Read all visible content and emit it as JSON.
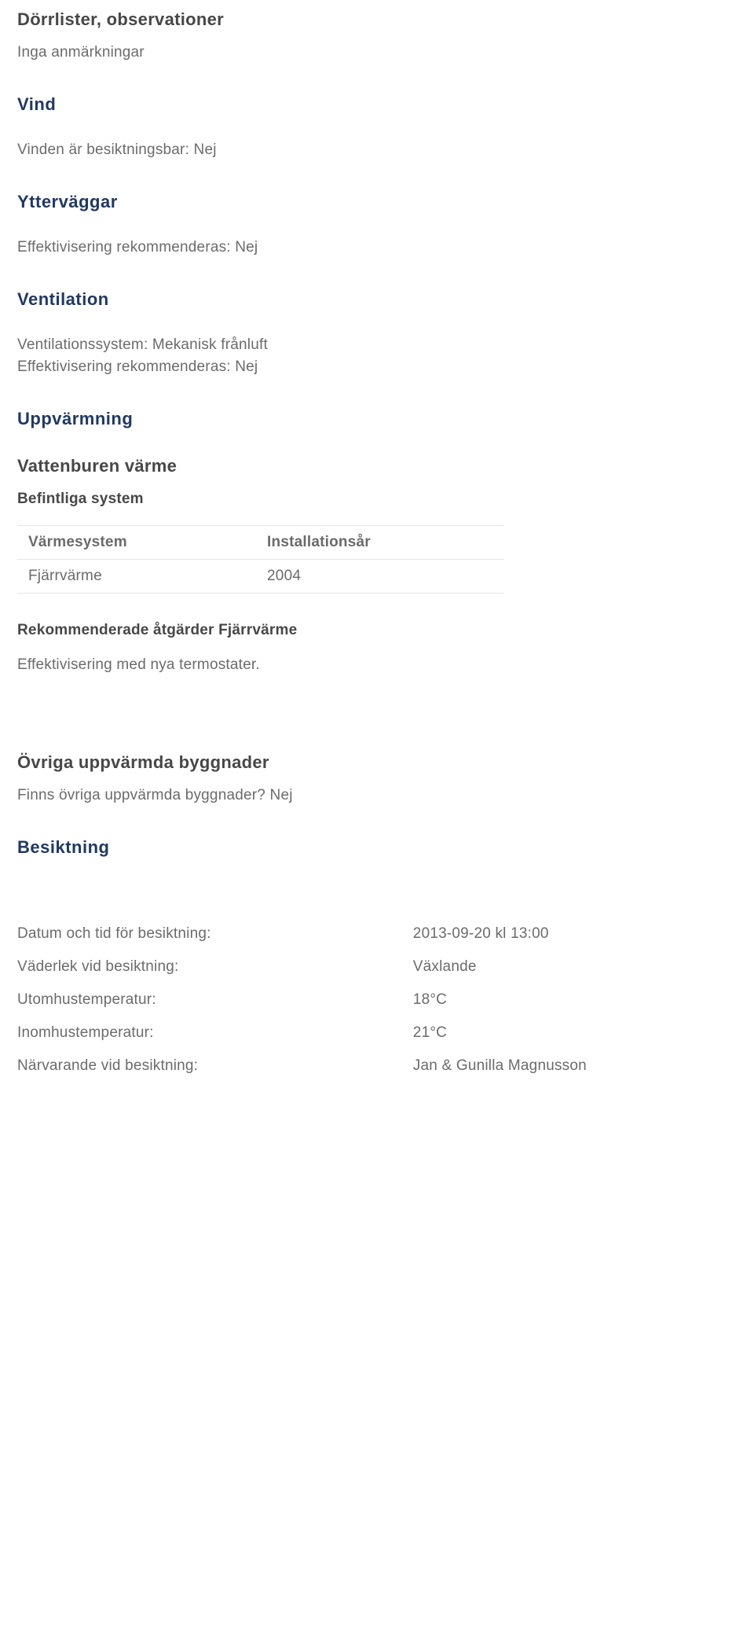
{
  "section_dorrlister": {
    "heading": "Dörrlister, observationer",
    "text": "Inga anmärkningar"
  },
  "section_vind": {
    "heading": "Vind",
    "text": "Vinden är besiktningsbar: Nej"
  },
  "section_yttervaggar": {
    "heading": "Ytterväggar",
    "text": "Effektivisering rekommenderas: Nej"
  },
  "section_ventilation": {
    "heading": "Ventilation",
    "line1": "Ventilationssystem: Mekanisk frånluft",
    "line2": "Effektivisering rekommenderas: Nej"
  },
  "section_uppvarmning": {
    "heading": "Uppvärmning",
    "subheading1": "Vattenburen värme",
    "befintliga_heading": "Befintliga system",
    "table": {
      "col1_header": "Värmesystem",
      "col2_header": "Installationsår",
      "row1_col1": "Fjärrvärme",
      "row1_col2": "2004"
    },
    "rekommenderade_heading": "Rekommenderade åtgärder Fjärrvärme",
    "rekommenderade_text": "Effektivisering med nya termostater."
  },
  "section_ovriga": {
    "heading": "Övriga uppvärmda byggnader",
    "text": "Finns övriga uppvärmda byggnader? Nej"
  },
  "section_besiktning": {
    "heading": "Besiktning",
    "rows": {
      "datum_label": "Datum och tid för besiktning:",
      "datum_value": "2013-09-20 kl 13:00",
      "vaderlek_label": "Väderlek vid besiktning:",
      "vaderlek_value": "Växlande",
      "utomhus_label": "Utomhustemperatur:",
      "utomhus_value": "18°C",
      "inomhus_label": "Inomhustemperatur:",
      "inomhus_value": "21°C",
      "narvarande_label": "Närvarande vid besiktning:",
      "narvarande_value": "Jan & Gunilla Magnusson"
    }
  }
}
